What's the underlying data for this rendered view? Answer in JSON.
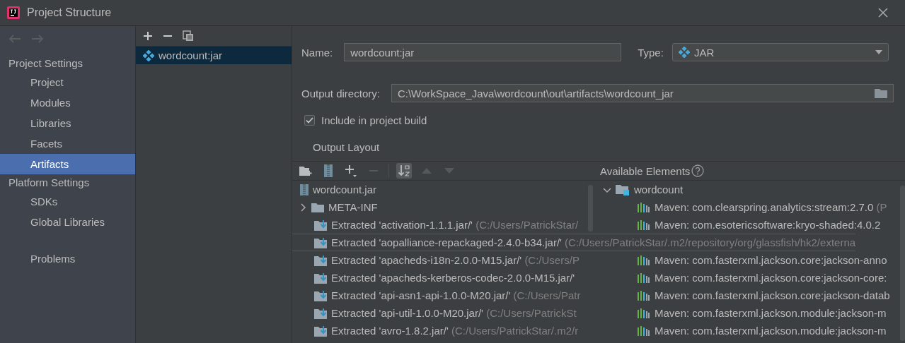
{
  "window": {
    "title": "Project Structure"
  },
  "sidebar": {
    "sections": [
      {
        "title": "Project Settings",
        "items": [
          {
            "label": "Project",
            "selected": false
          },
          {
            "label": "Modules",
            "selected": false
          },
          {
            "label": "Libraries",
            "selected": false
          },
          {
            "label": "Facets",
            "selected": false
          },
          {
            "label": "Artifacts",
            "selected": true
          }
        ]
      },
      {
        "title": "Platform Settings",
        "items": [
          {
            "label": "SDKs",
            "selected": false
          },
          {
            "label": "Global Libraries",
            "selected": false
          }
        ]
      }
    ],
    "extra_items": [
      {
        "label": "Problems",
        "selected": false
      }
    ]
  },
  "artifacts_list": {
    "items": [
      {
        "label": "wordcount:jar",
        "selected": true
      }
    ]
  },
  "editor": {
    "name": {
      "label": "Name:",
      "value": "wordcount:jar"
    },
    "type": {
      "label": "Type:",
      "value": "JAR"
    },
    "output_directory": {
      "label": "Output directory:",
      "value": "C:\\WorkSpace_Java\\wordcount\\out\\artifacts\\wordcount_jar"
    },
    "include_in_build": {
      "label": "Include in project build",
      "checked": true
    },
    "output_layout": {
      "title": "Output Layout",
      "toolbar": [
        {
          "kind": "new-folder",
          "disabled": false
        },
        {
          "kind": "archive",
          "disabled": false
        },
        {
          "kind": "add",
          "disabled": false
        },
        {
          "kind": "remove",
          "disabled": true
        },
        {
          "kind": "sort",
          "disabled": false,
          "on": true
        },
        {
          "kind": "up",
          "disabled": true
        },
        {
          "kind": "down",
          "disabled": true
        }
      ],
      "tree": [
        {
          "kind": "jar",
          "label": "wordcount.jar",
          "children": [
            {
              "kind": "folder",
              "label": "META-INF",
              "expanded": false
            },
            {
              "kind": "extracted",
              "label": "Extracted 'activation-1.1.1.jar/'",
              "detail": "(C:/Users/PatrickStar/",
              "hovered": false
            },
            {
              "kind": "extracted",
              "label": "Extracted 'aopalliance-repackaged-2.4.0-b34.jar/'",
              "detail": "(C:/Users/PatrickStar/.m2/repository/org/glassfish/hk2/externa",
              "hovered": true
            },
            {
              "kind": "extracted",
              "label": "Extracted 'apacheds-i18n-2.0.0-M15.jar/'",
              "detail": "(C:/Users/P",
              "hovered": false
            },
            {
              "kind": "extracted",
              "label": "Extracted 'apacheds-kerberos-codec-2.0.0-M15.jar/'",
              "hovered": false
            },
            {
              "kind": "extracted",
              "label": "Extracted 'api-asn1-api-1.0.0-M20.jar/'",
              "detail": "(C:/Users/Patr",
              "hovered": false
            },
            {
              "kind": "extracted",
              "label": "Extracted 'api-util-1.0.0-M20.jar/'",
              "detail": "(C:/Users/PatrickSt",
              "hovered": false
            },
            {
              "kind": "extracted",
              "label": "Extracted 'avro-1.8.2.jar/'",
              "detail": "(C:/Users/PatrickStar/.m2/r",
              "hovered": false
            }
          ]
        }
      ]
    },
    "available": {
      "title": "Available Elements",
      "tree": [
        {
          "kind": "module",
          "label": "wordcount",
          "expanded": true,
          "children": [
            {
              "kind": "library",
              "label": "Maven: com.clearspring.analytics:stream:2.7.0",
              "detail": "(P"
            },
            {
              "kind": "library",
              "label": "Maven: com.esotericsoftware:kryo-shaded:4.0.2"
            },
            {
              "kind": "hidden"
            },
            {
              "kind": "library",
              "label": "Maven: com.fasterxml.jackson.core:jackson-anno"
            },
            {
              "kind": "library",
              "label": "Maven: com.fasterxml.jackson.core:jackson-core:"
            },
            {
              "kind": "library",
              "label": "Maven: com.fasterxml.jackson.core:jackson-datab"
            },
            {
              "kind": "library",
              "label": "Maven: com.fasterxml.jackson.module:jackson-m"
            },
            {
              "kind": "library",
              "label": "Maven: com.fasterxml.jackson.module:jackson-m"
            }
          ]
        }
      ]
    }
  }
}
